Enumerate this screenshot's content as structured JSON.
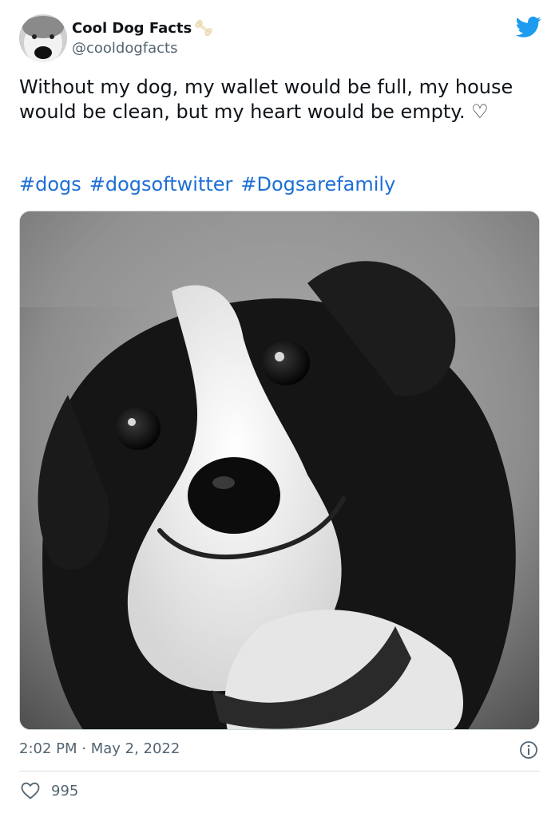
{
  "author": {
    "display_name": "Cool Dog Facts",
    "handle": "@cooldogfacts",
    "badge_icon": "bone-icon"
  },
  "tweet": {
    "text": "Without my dog, my wallet would be full, my house would be clean, but my heart would be empty. ♡",
    "hashtags": [
      "#dogs",
      "#dogsoftwitter",
      "#Dogsarefamily"
    ],
    "timestamp": "2:02 PM · May 2, 2022"
  },
  "engagement": {
    "likes": "995"
  },
  "icons": {
    "brand": "twitter-bird-icon",
    "info": "info-icon",
    "like": "heart-outline-icon"
  },
  "colors": {
    "twitter_blue": "#1d9bf0",
    "hashtag_blue": "#1d6fd6",
    "secondary_text": "#536471"
  }
}
